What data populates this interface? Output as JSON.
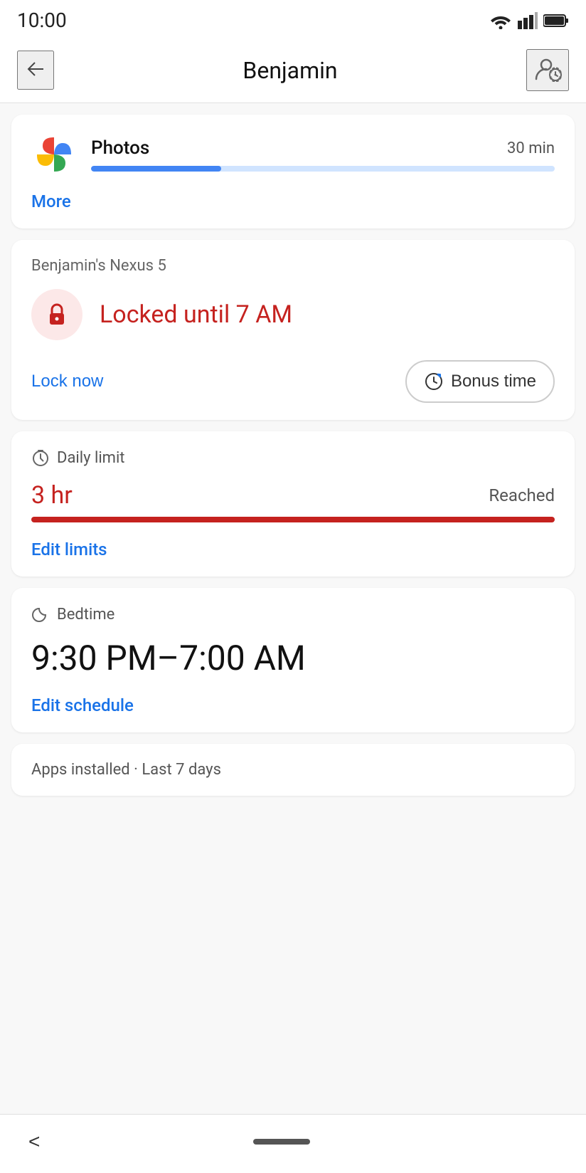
{
  "statusBar": {
    "time": "10:00"
  },
  "header": {
    "title": "Benjamin",
    "backLabel": "←",
    "accountLabel": "Account settings"
  },
  "photosCard": {
    "appName": "Photos",
    "timeUsed": "30 min",
    "progressPercent": 28,
    "moreLabel": "More"
  },
  "lockCard": {
    "deviceName": "Benjamin's Nexus 5",
    "lockStatus": "Locked until 7 AM",
    "lockNowLabel": "Lock now",
    "bonusTimeLabel": "Bonus time"
  },
  "dailyLimitCard": {
    "sectionLabel": "Daily limit",
    "limitValue": "3 hr",
    "reachedLabel": "Reached",
    "editLabel": "Edit limits"
  },
  "bedtimeCard": {
    "sectionLabel": "Bedtime",
    "schedule": "9:30 PM–7:00 AM",
    "editLabel": "Edit schedule"
  },
  "appsInstalledCard": {
    "label": "Apps installed · Last 7 days"
  },
  "bottomNav": {
    "backLabel": "<"
  },
  "colors": {
    "blue": "#1a73e8",
    "red": "#c5221f",
    "lightRed": "#fce8e8",
    "progressBlue": "#4285f4",
    "progressBlueBg": "#d0e4ff"
  }
}
